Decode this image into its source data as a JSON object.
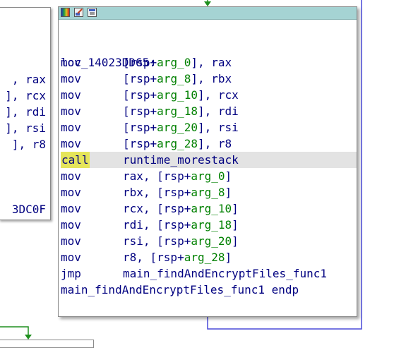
{
  "colors": {
    "titlebar": "#a5d3d3",
    "instruction_text": "#000080",
    "argument_text": "#008000",
    "selected_row_bg": "#e3e3e3",
    "call_highlight": "#e5e55a",
    "edge_blue": "#4a4ad8",
    "edge_green": "#1e8f1e"
  },
  "left_block": {
    "lines": [
      ", rax",
      "], rcx",
      "], rdi",
      "], rsi",
      "], r8",
      "3DC0F"
    ]
  },
  "node": {
    "titlebar_icons": [
      "color-palette-icon",
      "edit-node-icon",
      "graph-overview-icon"
    ],
    "label": "loc_14023DD65:",
    "rows": [
      {
        "mnemonic": "mov",
        "parts": [
          {
            "t": "[rsp+"
          },
          {
            "t": "arg_0",
            "arg": true
          },
          {
            "t": "], rax"
          }
        ]
      },
      {
        "mnemonic": "mov",
        "parts": [
          {
            "t": "[rsp+"
          },
          {
            "t": "arg_8",
            "arg": true
          },
          {
            "t": "], rbx"
          }
        ]
      },
      {
        "mnemonic": "mov",
        "parts": [
          {
            "t": "[rsp+"
          },
          {
            "t": "arg_10",
            "arg": true
          },
          {
            "t": "], rcx"
          }
        ]
      },
      {
        "mnemonic": "mov",
        "parts": [
          {
            "t": "[rsp+"
          },
          {
            "t": "arg_18",
            "arg": true
          },
          {
            "t": "], rdi"
          }
        ]
      },
      {
        "mnemonic": "mov",
        "parts": [
          {
            "t": "[rsp+"
          },
          {
            "t": "arg_20",
            "arg": true
          },
          {
            "t": "], rsi"
          }
        ]
      },
      {
        "mnemonic": "mov",
        "parts": [
          {
            "t": "[rsp+"
          },
          {
            "t": "arg_28",
            "arg": true
          },
          {
            "t": "], r8"
          }
        ]
      },
      {
        "mnemonic": "call",
        "highlight": true,
        "parts": [
          {
            "t": "runtime_morestack"
          }
        ]
      },
      {
        "mnemonic": "mov",
        "parts": [
          {
            "t": "rax, [rsp+"
          },
          {
            "t": "arg_0",
            "arg": true
          },
          {
            "t": "]"
          }
        ]
      },
      {
        "mnemonic": "mov",
        "parts": [
          {
            "t": "rbx, [rsp+"
          },
          {
            "t": "arg_8",
            "arg": true
          },
          {
            "t": "]"
          }
        ]
      },
      {
        "mnemonic": "mov",
        "parts": [
          {
            "t": "rcx, [rsp+"
          },
          {
            "t": "arg_10",
            "arg": true
          },
          {
            "t": "]"
          }
        ]
      },
      {
        "mnemonic": "mov",
        "parts": [
          {
            "t": "rdi, [rsp+"
          },
          {
            "t": "arg_18",
            "arg": true
          },
          {
            "t": "]"
          }
        ]
      },
      {
        "mnemonic": "mov",
        "parts": [
          {
            "t": "rsi, [rsp+"
          },
          {
            "t": "arg_20",
            "arg": true
          },
          {
            "t": "]"
          }
        ]
      },
      {
        "mnemonic": "mov",
        "parts": [
          {
            "t": "r8, [rsp+"
          },
          {
            "t": "arg_28",
            "arg": true
          },
          {
            "t": "]"
          }
        ]
      },
      {
        "mnemonic": "jmp",
        "parts": [
          {
            "t": "main_findAndEncryptFiles_func1"
          }
        ]
      }
    ],
    "footer": "main_findAndEncryptFiles_func1 endp"
  }
}
